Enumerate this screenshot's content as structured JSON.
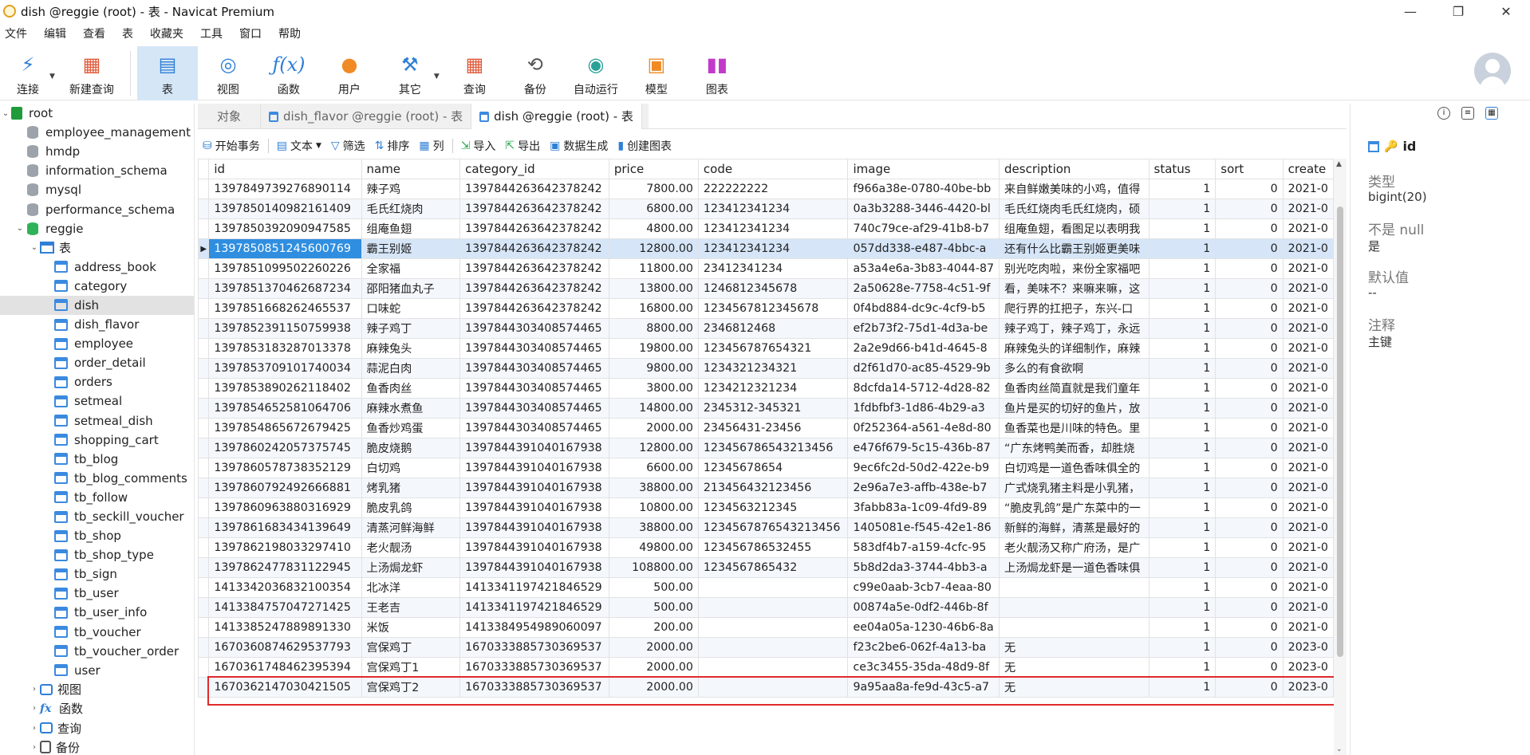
{
  "window": {
    "title": "dish @reggie (root) - 表 - Navicat Premium"
  },
  "menu": [
    "文件",
    "编辑",
    "查看",
    "表",
    "收藏夹",
    "工具",
    "窗口",
    "帮助"
  ],
  "toolbar": {
    "connect": "连接",
    "new_query": "新建查询",
    "table": "表",
    "view": "视图",
    "function": "函数",
    "user": "用户",
    "other": "其它",
    "query": "查询",
    "backup": "备份",
    "automation": "自动运行",
    "model": "模型",
    "chart": "图表"
  },
  "sidebar": {
    "root": "root",
    "databases": [
      "employee_management",
      "hmdp",
      "information_schema",
      "mysql",
      "performance_schema"
    ],
    "active_db": "reggie",
    "tables_label": "表",
    "tables": [
      "address_book",
      "category",
      "dish",
      "dish_flavor",
      "employee",
      "order_detail",
      "orders",
      "setmeal",
      "setmeal_dish",
      "shopping_cart",
      "tb_blog",
      "tb_blog_comments",
      "tb_follow",
      "tb_seckill_voucher",
      "tb_shop",
      "tb_shop_type",
      "tb_sign",
      "tb_user",
      "tb_user_info",
      "tb_voucher",
      "tb_voucher_order",
      "user"
    ],
    "selected_table": "dish",
    "views_label": "视图",
    "functions_label": "函数",
    "queries_label": "查询",
    "backups_label": "备份"
  },
  "tabs": {
    "objects": "对象",
    "dish_flavor": "dish_flavor @reggie (root) - 表",
    "dish": "dish @reggie (root) - 表"
  },
  "actions": {
    "begin_tx": "开始事务",
    "text": "文本",
    "filter": "筛选",
    "sort": "排序",
    "columns": "列",
    "import": "导入",
    "export": "导出",
    "generate": "数据生成",
    "create_chart": "创建图表"
  },
  "grid": {
    "columns": [
      "id",
      "name",
      "category_id",
      "price",
      "code",
      "image",
      "description",
      "status",
      "sort",
      "create"
    ],
    "rows": [
      [
        "1397849739276890114",
        "辣子鸡",
        "1397844263642378242",
        "7800.00",
        "222222222",
        "f966a38e-0780-40be-bb",
        "来自鲜嫩美味的小鸡，值得",
        "1",
        "0",
        "2021-0"
      ],
      [
        "1397850140982161409",
        "毛氏红烧肉",
        "1397844263642378242",
        "6800.00",
        "123412341234",
        "0a3b3288-3446-4420-bl",
        "毛氏红烧肉毛氏红烧肉，硕",
        "1",
        "0",
        "2021-0"
      ],
      [
        "1397850392090947585",
        "组庵鱼翅",
        "1397844263642378242",
        "4800.00",
        "123412341234",
        "740c79ce-af29-41b8-b7",
        "组庵鱼翅，看图足以表明我",
        "1",
        "0",
        "2021-0"
      ],
      [
        "1397850851245600769",
        "霸王别姬",
        "1397844263642378242",
        "12800.00",
        "123412341234",
        "057dd338-e487-4bbc-a",
        "还有什么比霸王别姬更美味",
        "1",
        "0",
        "2021-0"
      ],
      [
        "1397851099502260226",
        "全家福",
        "1397844263642378242",
        "11800.00",
        "23412341234",
        "a53a4e6a-3b83-4044-87",
        "别光吃肉啦，来份全家福吧",
        "1",
        "0",
        "2021-0"
      ],
      [
        "1397851370462687234",
        "邵阳猪血丸子",
        "1397844263642378242",
        "13800.00",
        "1246812345678",
        "2a50628e-7758-4c51-9f",
        "看，美味不？来嘛来嘛，这",
        "1",
        "0",
        "2021-0"
      ],
      [
        "1397851668262465537",
        "口味蛇",
        "1397844263642378242",
        "16800.00",
        "1234567812345678",
        "0f4bd884-dc9c-4cf9-b5",
        "爬行界的扛把子，东兴-口",
        "1",
        "0",
        "2021-0"
      ],
      [
        "1397852391150759938",
        "辣子鸡丁",
        "1397844303408574465",
        "8800.00",
        "2346812468",
        "ef2b73f2-75d1-4d3a-be",
        "辣子鸡丁，辣子鸡丁，永远",
        "1",
        "0",
        "2021-0"
      ],
      [
        "1397853183287013378",
        "麻辣兔头",
        "1397844303408574465",
        "19800.00",
        "123456787654321",
        "2a2e9d66-b41d-4645-8",
        "麻辣兔头的详细制作，麻辣",
        "1",
        "0",
        "2021-0"
      ],
      [
        "1397853709101740034",
        "蒜泥白肉",
        "1397844303408574465",
        "9800.00",
        "1234321234321",
        "d2f61d70-ac85-4529-9b",
        "多么的有食欲啊",
        "1",
        "0",
        "2021-0"
      ],
      [
        "1397853890262118402",
        "鱼香肉丝",
        "1397844303408574465",
        "3800.00",
        "1234212321234",
        "8dcfda14-5712-4d28-82",
        "鱼香肉丝简直就是我们童年",
        "1",
        "0",
        "2021-0"
      ],
      [
        "1397854652581064706",
        "麻辣水煮鱼",
        "1397844303408574465",
        "14800.00",
        "2345312-345321",
        "1fdbfbf3-1d86-4b29-a3",
        "鱼片是买的切好的鱼片，放",
        "1",
        "0",
        "2021-0"
      ],
      [
        "1397854865672679425",
        "鱼香炒鸡蛋",
        "1397844303408574465",
        "2000.00",
        "23456431-23456",
        "0f252364-a561-4e8d-80",
        "鱼香菜也是川味的特色。里",
        "1",
        "0",
        "2021-0"
      ],
      [
        "1397860242057375745",
        "脆皮烧鹅",
        "1397844391040167938",
        "12800.00",
        "123456786543213456",
        "e476f679-5c15-436b-87",
        "“广东烤鸭美而香，却胜烧",
        "1",
        "0",
        "2021-0"
      ],
      [
        "1397860578738352129",
        "白切鸡",
        "1397844391040167938",
        "6600.00",
        "12345678654",
        "9ec6fc2d-50d2-422e-b9",
        "白切鸡是一道色香味俱全的",
        "1",
        "0",
        "2021-0"
      ],
      [
        "1397860792492666881",
        "烤乳猪",
        "1397844391040167938",
        "38800.00",
        "213456432123456",
        "2e96a7e3-affb-438e-b7",
        "广式烧乳猪主料是小乳猪，",
        "1",
        "0",
        "2021-0"
      ],
      [
        "1397860963880316929",
        "脆皮乳鸽",
        "1397844391040167938",
        "10800.00",
        "1234563212345",
        "3fabb83a-1c09-4fd9-89",
        "“脆皮乳鸽”是广东菜中的一",
        "1",
        "0",
        "2021-0"
      ],
      [
        "1397861683434139649",
        "清蒸河鲜海鲜",
        "1397844391040167938",
        "38800.00",
        "1234567876543213456",
        "1405081e-f545-42e1-86",
        "新鲜的海鲜，清蒸是最好的",
        "1",
        "0",
        "2021-0"
      ],
      [
        "1397862198033297410",
        "老火靓汤",
        "1397844391040167938",
        "49800.00",
        "123456786532455",
        "583df4b7-a159-4cfc-95",
        "老火靓汤又称广府汤，是广",
        "1",
        "0",
        "2021-0"
      ],
      [
        "1397862477831122945",
        "上汤焗龙虾",
        "1397844391040167938",
        "108800.00",
        "1234567865432",
        "5b8d2da3-3744-4bb3-a",
        "上汤焗龙虾是一道色香味俱",
        "1",
        "0",
        "2021-0"
      ],
      [
        "1413342036832100354",
        "北冰洋",
        "1413341197421846529",
        "500.00",
        "",
        "c99e0aab-3cb7-4eaa-80",
        "",
        "1",
        "0",
        "2021-0"
      ],
      [
        "1413384757047271425",
        "王老吉",
        "1413341197421846529",
        "500.00",
        "",
        "00874a5e-0df2-446b-8f",
        "",
        "1",
        "0",
        "2021-0"
      ],
      [
        "1413385247889891330",
        "米饭",
        "1413384954989060097",
        "200.00",
        "",
        "ee04a05a-1230-46b6-8a",
        "",
        "1",
        "0",
        "2021-0"
      ],
      [
        "1670360874629537793",
        "宫保鸡丁",
        "1670333885730369537",
        "2000.00",
        "",
        "f23c2be6-062f-4a13-ba",
        "无",
        "1",
        "0",
        "2023-0"
      ],
      [
        "1670361748462395394",
        "宫保鸡丁1",
        "1670333885730369537",
        "2000.00",
        "",
        "ce3c3455-35da-48d9-8f",
        "无",
        "1",
        "0",
        "2023-0"
      ],
      [
        "1670362147030421505",
        "宫保鸡丁2",
        "1670333885730369537",
        "2000.00",
        "",
        "9a95aa8a-fe9d-43c5-a7",
        "无",
        "1",
        "0",
        "2023-0"
      ]
    ],
    "selected_row_index": 3
  },
  "properties": {
    "field_name": "id",
    "type_label": "类型",
    "type_value": "bigint(20)",
    "notnull_label": "不是 null",
    "notnull_value": "是",
    "default_label": "默认值",
    "default_value": "--",
    "comment_label": "注释",
    "comment_value": "主键"
  }
}
